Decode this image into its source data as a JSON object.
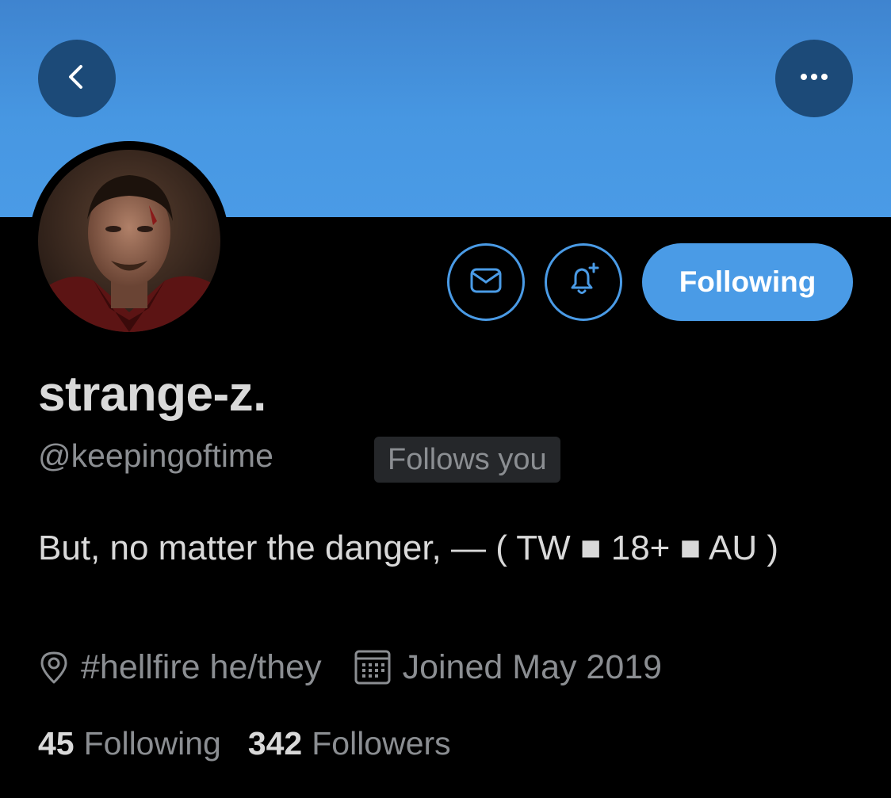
{
  "header": {
    "back_icon": "chevron-left-icon",
    "more_icon": "more-horizontal-icon",
    "banner_color": "#4a9be6"
  },
  "profile": {
    "avatar_icon": "avatar-portrait",
    "display_name": "strange-z.",
    "handle": "@keepingoftime",
    "follows_you_badge": "Follows you",
    "bio": "But, no matter the danger, — ( TW ■ 18+ ■ AU )",
    "location": "#hellfire he/they",
    "joined": "Joined May 2019"
  },
  "actions": {
    "message_icon": "mail-icon",
    "notify_icon": "bell-plus-icon",
    "following_label": "Following",
    "accent_color": "#4a9be6"
  },
  "stats": {
    "following_count": "45",
    "following_label": "Following",
    "followers_count": "342",
    "followers_label": "Followers"
  }
}
